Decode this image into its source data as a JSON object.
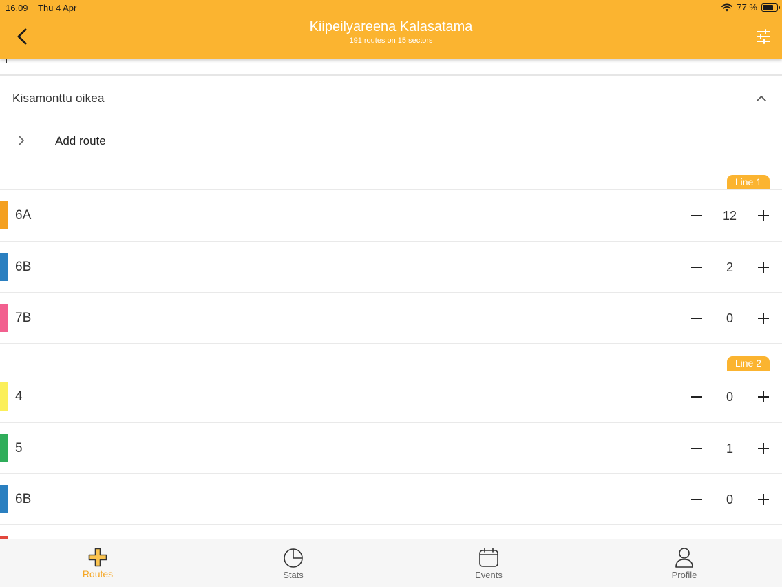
{
  "status_bar": {
    "time": "16.09",
    "date": "Thu 4 Apr",
    "battery": "77 %",
    "battery_level": 0.77
  },
  "header": {
    "title": "Kiipeilyareena Kalasatama",
    "subtitle": "191 routes on 15 sectors",
    "back_icon": "chevron-left-icon",
    "filter_icon": "sliders-icon",
    "background_color": "#fbb430"
  },
  "sector": {
    "title": "Kisamonttu oikea",
    "add_route_label": "Add route"
  },
  "lines": [
    {
      "label": "Line 1",
      "routes": [
        {
          "grade": "6A",
          "color": "#f4a020",
          "count": "12"
        },
        {
          "grade": "6B",
          "color": "#2a7fc0",
          "count": "2"
        },
        {
          "grade": "7B",
          "color": "#f2608f",
          "count": "0"
        }
      ]
    },
    {
      "label": "Line 2",
      "routes": [
        {
          "grade": "4",
          "color": "#fbef5a",
          "count": "0"
        },
        {
          "grade": "5",
          "color": "#2fad5a",
          "count": "1"
        },
        {
          "grade": "6B",
          "color": "#2a7fc0",
          "count": "0"
        }
      ]
    }
  ],
  "tabs": [
    {
      "label": "Routes",
      "icon": "plus-hold-icon",
      "active": true
    },
    {
      "label": "Stats",
      "icon": "pie-chart-icon",
      "active": false
    },
    {
      "label": "Events",
      "icon": "calendar-icon",
      "active": false
    },
    {
      "label": "Profile",
      "icon": "person-icon",
      "active": false
    }
  ],
  "accent_color": "#f5a623"
}
